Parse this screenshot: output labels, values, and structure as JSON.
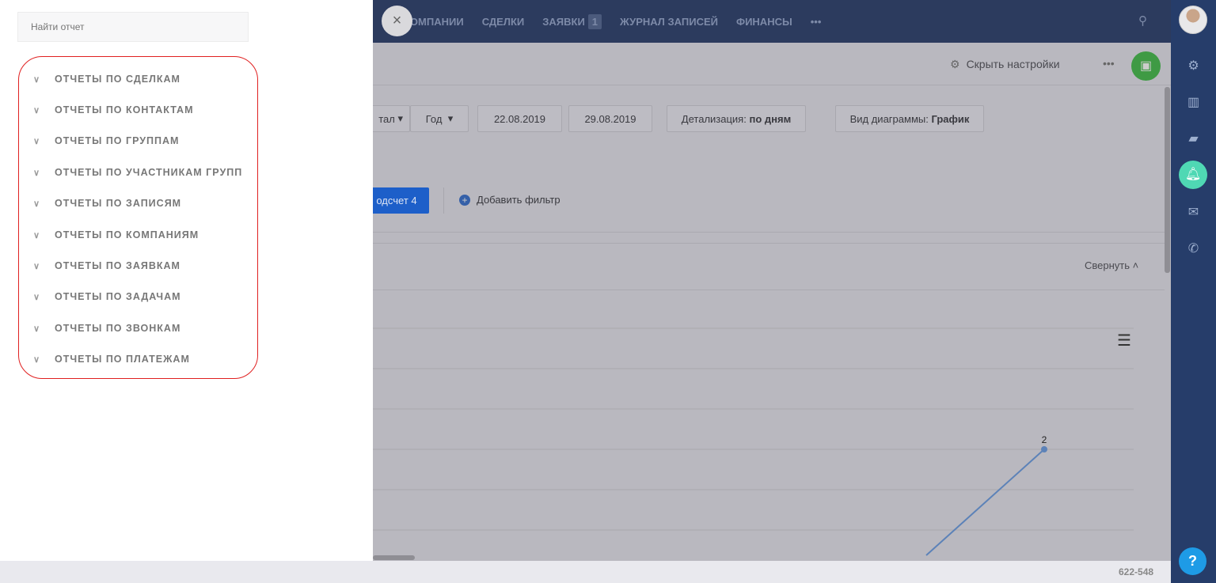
{
  "nav": {
    "items": [
      "КОМПАНИИ",
      "СДЕЛКИ",
      "ЗАЯВКИ",
      "ЖУРНАЛ ЗАПИСЕЙ",
      "ФИНАНСЫ"
    ],
    "requests_badge": "1",
    "more": "•••"
  },
  "toolbar": {
    "hide_settings": "Скрыть настройки",
    "more": "•••"
  },
  "filters": {
    "portal": "тал",
    "period": "Год",
    "date_from": "22.08.2019",
    "date_to": "29.08.2019",
    "detail_label": "Детализация:",
    "detail_value": "по дням",
    "chart_type_label": "Вид диаграммы:",
    "chart_type_value": "График",
    "count_button": "одсчет 4",
    "add_filter": "Добавить фильтр"
  },
  "chart": {
    "collapse": "Свернуть",
    "point_label": "2"
  },
  "footer": {
    "code": "622-548"
  },
  "panel": {
    "search_placeholder": "Найти отчет",
    "items": [
      "ОТЧЕТЫ ПО СДЕЛКАМ",
      "ОТЧЕТЫ ПО КОНТАКТАМ",
      "ОТЧЕТЫ ПО ГРУППАМ",
      "ОТЧЕТЫ ПО УЧАСТНИКАМ ГРУПП",
      "ОТЧЕТЫ ПО ЗАПИСЯМ",
      "ОТЧЕТЫ ПО КОМПАНИЯМ",
      "ОТЧЕТЫ ПО ЗАЯВКАМ",
      "ОТЧЕТЫ ПО ЗАДАЧАМ",
      "ОТЧЕТЫ ПО ЗВОНКАМ",
      "ОТЧЕТЫ ПО ПЛАТЕЖАМ"
    ]
  },
  "colors": {
    "header": "#2c3b5e",
    "sidebar": "#263d6a",
    "highlight": "#e02020",
    "save": "#3f9a44",
    "notify": "#4fd8b4"
  }
}
